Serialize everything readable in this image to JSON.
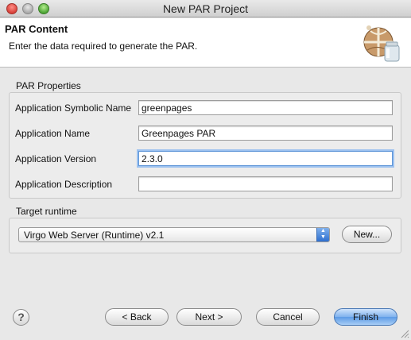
{
  "window": {
    "title": "New PAR Project"
  },
  "banner": {
    "title": "PAR Content",
    "description": "Enter the data required to generate the PAR.",
    "icon": "par-archive-icon"
  },
  "par_properties": {
    "label": "PAR Properties",
    "fields": [
      {
        "label": "Application Symbolic Name",
        "value": "greenpages"
      },
      {
        "label": "Application Name",
        "value": "Greenpages PAR"
      },
      {
        "label": "Application Version",
        "value": "2.3.0"
      },
      {
        "label": "Application Description",
        "value": ""
      }
    ]
  },
  "target_runtime": {
    "label": "Target runtime",
    "selected": "Virgo Web Server (Runtime) v2.1",
    "new_button": "New..."
  },
  "footer": {
    "help_icon": "question-mark-icon",
    "back": "< Back",
    "next": "Next >",
    "cancel": "Cancel",
    "finish": "Finish"
  }
}
